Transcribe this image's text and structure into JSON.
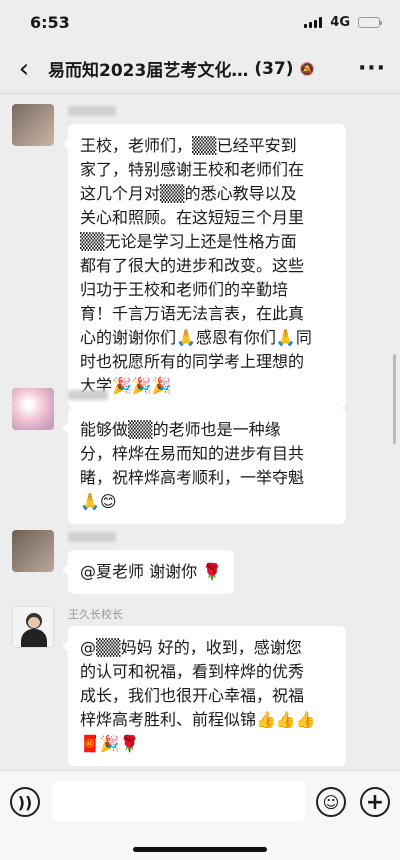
{
  "status": {
    "time": "6:53",
    "network": "4G"
  },
  "nav": {
    "back_label": "‹",
    "title": "易而知2023届艺考文化…",
    "member_count": "(37)",
    "mute_icon": "bell-off-icon",
    "more_label": "···"
  },
  "messages": [
    {
      "sender": "",
      "lines": [
        "王校，老师们，▒▒已经平安到",
        "家了，特别感谢王校和老师们在",
        "这几个月对▒▒的悉心教导以及",
        "关心和照顾。在这短短三个月里",
        "▒▒无论是学习上还是性格方面",
        "都有了很大的进步和改变。这些",
        "归功于王校和老师们的辛勤培",
        "育！千言万语无法言表，在此真",
        "心的谢谢你们🙏感恩有你们🙏同",
        "时也祝愿所有的同学考上理想的",
        "大学🎉🎉🎉"
      ]
    },
    {
      "sender": "",
      "lines": [
        "能够做▒▒的老师也是一种缘",
        "分，梓烨在易而知的进步有目共",
        "睹，祝梓烨高考顺利，一举夺魁",
        "🙏😊"
      ]
    },
    {
      "sender": "",
      "lines": [
        "@夏老师 谢谢你 🌹"
      ]
    },
    {
      "sender": "王久长校长",
      "lines": [
        "@▒▒妈妈 好的，收到，感谢您",
        "的认可和祝福，看到梓烨的优秀",
        "成长，我们也很开心幸福，祝福",
        "梓烨高考胜利、前程似锦👍👍👍",
        "🧧🎉🌹"
      ]
    }
  ],
  "input": {
    "voice_icon": "voice-icon",
    "emoji_icon": "emoji-icon",
    "plus_icon": "plus-icon"
  }
}
